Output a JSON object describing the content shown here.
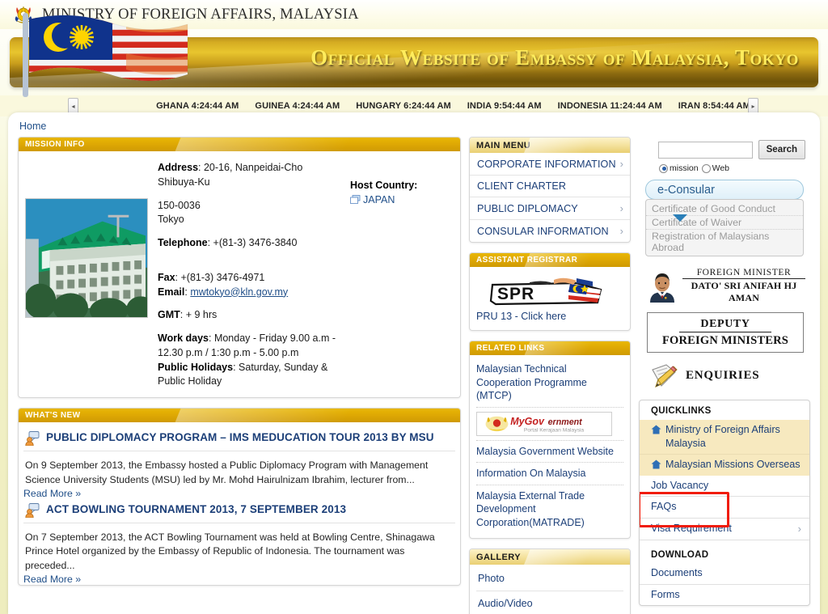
{
  "header": {
    "ministry_title": "MINISTRY OF FOREIGN AFFAIRS, MALAYSIA",
    "banner_title": "Official Website of Embassy of Malaysia, Tokyo",
    "emblem_icon": "malaysia-coat-of-arms-icon",
    "flag_icon": "malaysia-flag-icon"
  },
  "ticker": {
    "prev_label": "◂",
    "next_label": "▸",
    "clocks": [
      {
        "country": "GHANA",
        "time": "4:24:44 AM"
      },
      {
        "country": "GUINEA",
        "time": "4:24:44 AM"
      },
      {
        "country": "HUNGARY",
        "time": "6:24:44 AM"
      },
      {
        "country": "INDIA",
        "time": "9:54:44 AM"
      },
      {
        "country": "INDONESIA",
        "time": "11:24:44 AM"
      },
      {
        "country": "IRAN",
        "time": "8:54:44 AM"
      }
    ]
  },
  "breadcrumb": "Home",
  "mission_info": {
    "title": "MISSION INFO",
    "photo_icon": "embassy-building-photo",
    "address_label": "Address",
    "address_line1": ": 20-16, Nanpeidai-Cho",
    "address_line2": "Shibuya-Ku",
    "postcode": "150-0036",
    "city": "Tokyo",
    "telephone_label": "Telephone",
    "telephone": ": +(81-3) 3476-3840",
    "fax_label": "Fax",
    "fax": ": +(81-3) 3476-4971",
    "email_label": "Email",
    "email_sep": ": ",
    "email": "mwtokyo@kln.gov.my",
    "gmt_label": "GMT",
    "gmt": ": + 9 hrs",
    "workdays_label": "Work days",
    "workdays": ": Monday - Friday 9.00 a.m - 12.30 p.m / 1:30 p.m - 5.00 p.m",
    "holidays_label": "Public Holidays",
    "holidays": ": Saturday, Sunday & Public Holiday",
    "host_country_label": "Host Country:",
    "host_country": "JAPAN",
    "host_country_icon": "new-window-icon"
  },
  "whats_new": {
    "title": "WHAT'S NEW",
    "items": [
      {
        "icon": "news-person-icon",
        "title": "PUBLIC DIPLOMACY PROGRAM – IMS MEDUCATION TOUR 2013 BY MSU",
        "body": "On 9 September 2013, the Embassy hosted a Public Diplomacy Program with Management Science University Students (MSU) led by Mr. Mohd Hairulnizam Ibrahim, lecturer from...",
        "read_more": "Read More »"
      },
      {
        "icon": "news-person-icon",
        "title": "ACT BOWLING TOURNAMENT 2013, 7 SEPTEMBER 2013",
        "body": "  On 7 September 2013, the ACT Bowling Tournament was held at Bowling Centre, Shinagawa Prince Hotel organized by the Embassy of Republic of Indonesia.   The tournament was preceded...",
        "read_more": "Read More »"
      }
    ]
  },
  "main_menu": {
    "title": "MAIN MENU",
    "items": [
      {
        "label": "CORPORATE INFORMATION",
        "chevron": "›"
      },
      {
        "label": "CLIENT CHARTER",
        "chevron": ""
      },
      {
        "label": "PUBLIC DIPLOMACY",
        "chevron": "›"
      },
      {
        "label": "CONSULAR INFORMATION",
        "chevron": "›"
      }
    ]
  },
  "assistant_registrar": {
    "title": "ASSISTANT REGISTRAR",
    "logo_text": "SPR",
    "logo_icon": "spr-logo-icon",
    "link": "PRU 13 - Click here"
  },
  "related_links": {
    "title": "RELATED LINKS",
    "items": [
      {
        "label": "Malaysian Technical Cooperation Programme (MTCP)",
        "type": "text"
      },
      {
        "label": "MyGovernment",
        "sublabel": "Portal Kerajaan Malaysia",
        "type": "banner",
        "icon": "mygovernment-banner-icon"
      },
      {
        "label": "Malaysia Government Website",
        "type": "text"
      },
      {
        "label": "Information On Malaysia",
        "type": "text"
      },
      {
        "label": "Malaysia External Trade Development Corporation(MATRADE)",
        "type": "text"
      }
    ]
  },
  "gallery": {
    "title": "GALLERY",
    "items": [
      "Photo",
      "Audio/Video"
    ]
  },
  "search": {
    "value": "",
    "placeholder": "",
    "button_label": "Search",
    "scope_mission": "mission",
    "scope_web": "Web",
    "selected_scope": "mission"
  },
  "econsular": {
    "button_label": "e-Consular",
    "items": [
      "Certificate of Good Conduct",
      "Certificate of Waiver",
      "Registration of Malaysians Abroad"
    ]
  },
  "foreign_minister": {
    "photo_icon": "foreign-minister-photo",
    "title": "FOREIGN MINISTER",
    "name": "DATO' SRI ANIFAH HJ AMAN",
    "deputy_line1": "DEPUTY",
    "deputy_line2": "FOREIGN MINISTERS",
    "enquiries_icon": "notepad-pencil-icon",
    "enquiries_label": "ENQUIRIES"
  },
  "quicklinks": {
    "title": "QUICKLINKS",
    "items": [
      {
        "label": "Ministry of Foreign Affairs Malaysia",
        "icon": "home-icon",
        "highlighted": true
      },
      {
        "label": "Malaysian Missions Overseas",
        "icon": "home-icon",
        "highlighted": true
      },
      {
        "label": "Job Vacancy",
        "icon": "",
        "highlighted": false
      },
      {
        "label": "FAQs",
        "icon": "",
        "highlighted": false
      },
      {
        "label": "Visa Requirement",
        "icon": "",
        "chevron": "›",
        "highlighted": false
      }
    ],
    "download_title": "DOWNLOAD",
    "download_items": [
      "Documents",
      "Forms"
    ],
    "highlight_color": "#f01c0b"
  }
}
